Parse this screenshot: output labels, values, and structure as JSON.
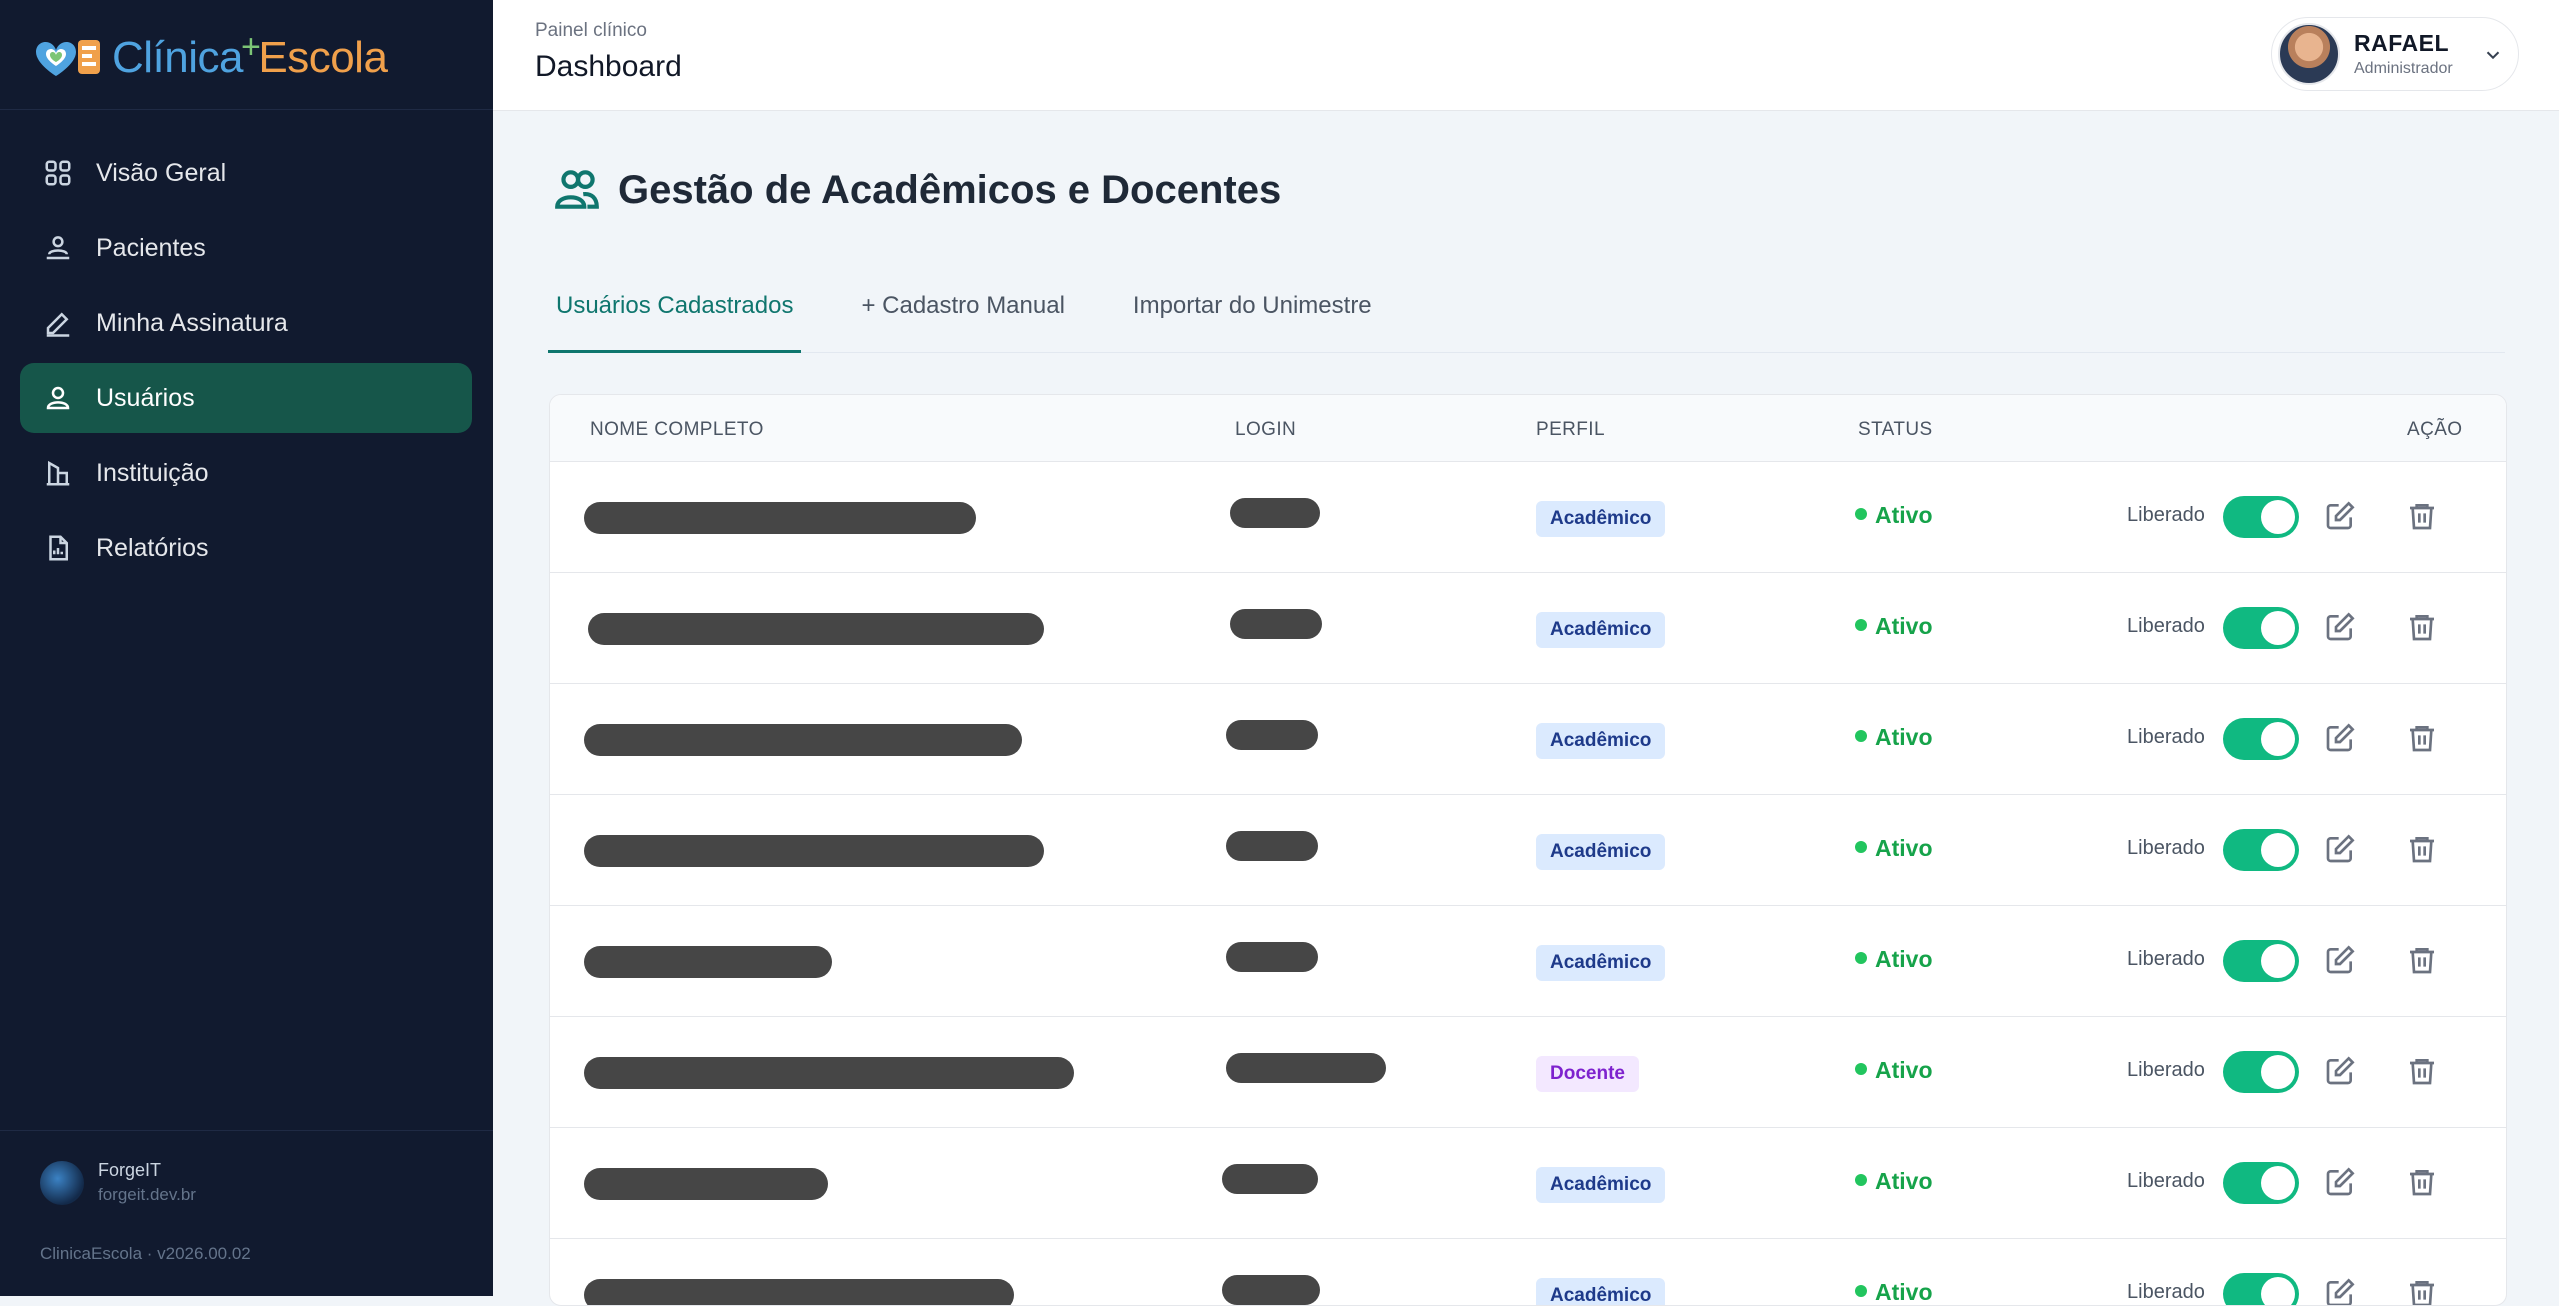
{
  "app": {
    "logo_part1": "Clínica",
    "logo_part2": "Escola",
    "version": "ClinicaEscola · v2026.00.02"
  },
  "brand": {
    "name": "ForgeIT",
    "url": "forgeit.dev.br"
  },
  "colors": {
    "sidebar_bg": "#111a2f",
    "active_nav": "#16564a",
    "accent": "#0f766e",
    "toggle_on": "#10b981",
    "status_active": "#16a34a"
  },
  "sidebar": {
    "items": [
      {
        "label": "Visão Geral",
        "icon": "grid-icon"
      },
      {
        "label": "Pacientes",
        "icon": "patients-icon"
      },
      {
        "label": "Minha Assinatura",
        "icon": "pen-icon"
      },
      {
        "label": "Usuários",
        "icon": "user-icon",
        "active": true
      },
      {
        "label": "Instituição",
        "icon": "building-icon"
      },
      {
        "label": "Relatórios",
        "icon": "report-icon"
      }
    ]
  },
  "header": {
    "subtitle": "Painel clínico",
    "title": "Dashboard"
  },
  "user": {
    "name": "RAFAEL",
    "role": "Administrador"
  },
  "main": {
    "title": "Gestão de Acadêmicos e Docentes",
    "tabs": [
      {
        "label": "Usuários Cadastrados",
        "active": true
      },
      {
        "label": "+ Cadastro Manual"
      },
      {
        "label": "Importar do Unimestre"
      }
    ]
  },
  "table": {
    "columns": [
      "NOME COMPLETO",
      "LOGIN",
      "PERFIL",
      "STATUS",
      "AÇÃO"
    ],
    "rows": [
      {
        "perfil": "Acadêmico",
        "status": "Ativo",
        "liberado_label": "Liberado",
        "liberado": true
      },
      {
        "perfil": "Acadêmico",
        "status": "Ativo",
        "liberado_label": "Liberado",
        "liberado": true
      },
      {
        "perfil": "Acadêmico",
        "status": "Ativo",
        "liberado_label": "Liberado",
        "liberado": true
      },
      {
        "perfil": "Acadêmico",
        "status": "Ativo",
        "liberado_label": "Liberado",
        "liberado": true
      },
      {
        "perfil": "Acadêmico",
        "status": "Ativo",
        "liberado_label": "Liberado",
        "liberado": true
      },
      {
        "perfil": "Docente",
        "status": "Ativo",
        "liberado_label": "Liberado",
        "liberado": true
      },
      {
        "perfil": "Acadêmico",
        "status": "Ativo",
        "liberado_label": "Liberado",
        "liberado": true
      },
      {
        "perfil": "Acadêmico",
        "status": "Ativo",
        "liberado_label": "Liberado",
        "liberado": true
      }
    ]
  }
}
